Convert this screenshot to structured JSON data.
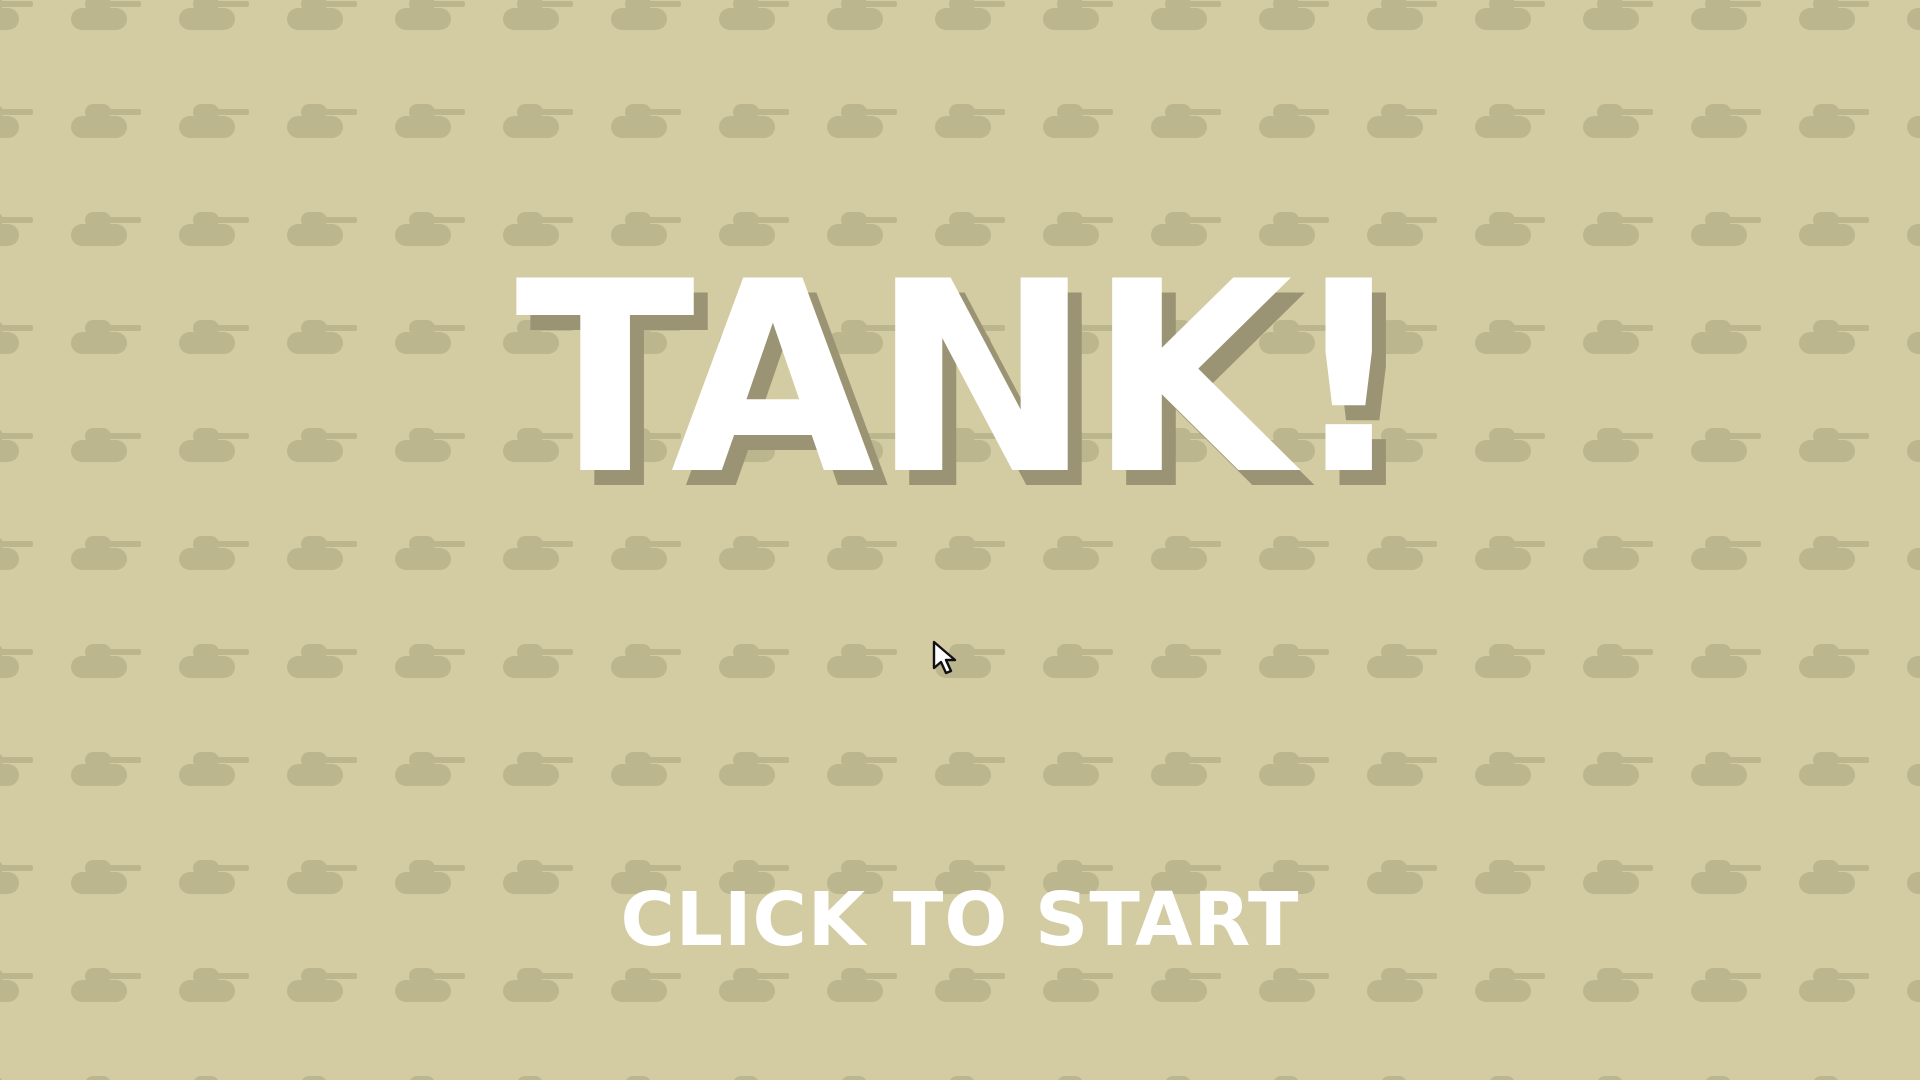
{
  "game": {
    "title": "TANK!",
    "start_prompt": "CLICK TO START"
  },
  "icons": {
    "background_tile": "tank-silhouette-icon",
    "pointer": "mouse-pointer-icon"
  },
  "colors": {
    "background": "#d3cba1",
    "tank_pattern": "#bcb68f",
    "title_text": "#ffffff",
    "title_shadow": "#9b9474",
    "start_text": "#ffffff"
  }
}
